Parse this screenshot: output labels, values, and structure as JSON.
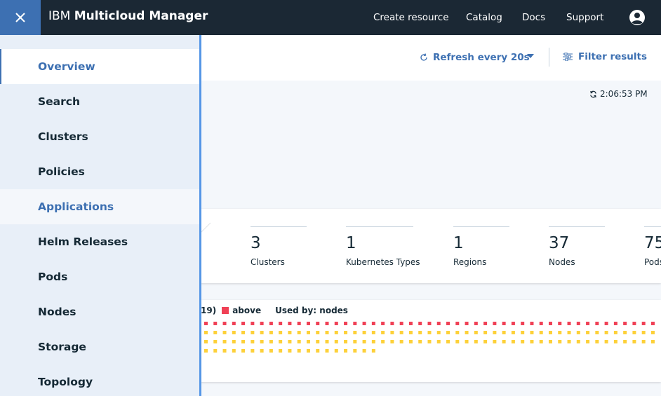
{
  "topbar": {
    "brand_prefix": "IBM",
    "brand_name": "Multicloud Manager",
    "links": [
      "Create resource",
      "Catalog",
      "Docs",
      "Support"
    ]
  },
  "toolbar": {
    "refresh_label": "Refresh every 20s",
    "filter_label": "Filter results"
  },
  "timestamp": "2:06:53 PM",
  "summary": [
    {
      "value": "3",
      "label": "Clusters"
    },
    {
      "value": "1",
      "label": "Kubernetes Types"
    },
    {
      "value": "1",
      "label": "Regions"
    },
    {
      "value": "37",
      "label": "Nodes"
    },
    {
      "value": "75",
      "label": "Pods"
    }
  ],
  "usage": {
    "legend_prefix": "19)",
    "legend_above": "above",
    "used_by": "Used by: nodes",
    "rows": [
      {
        "color": "#f04156",
        "count": 49
      },
      {
        "color": "#fdd13a",
        "count": 49
      },
      {
        "color": "#fdd13a",
        "count": 49
      },
      {
        "color": "#fdd13a",
        "count": 19
      }
    ]
  },
  "sidebar": {
    "items": [
      {
        "label": "Overview",
        "state": "active"
      },
      {
        "label": "Search",
        "state": ""
      },
      {
        "label": "Clusters",
        "state": ""
      },
      {
        "label": "Policies",
        "state": ""
      },
      {
        "label": "Applications",
        "state": "hover"
      },
      {
        "label": "Helm Releases",
        "state": ""
      },
      {
        "label": "Pods",
        "state": ""
      },
      {
        "label": "Nodes",
        "state": ""
      },
      {
        "label": "Storage",
        "state": ""
      },
      {
        "label": "Topology",
        "state": ""
      }
    ]
  },
  "colors": {
    "topbar": "#1b2834",
    "accent": "#3d70b2",
    "sidebar": "#e8eff8",
    "above": "#f04156",
    "warning": "#fdd13a"
  }
}
